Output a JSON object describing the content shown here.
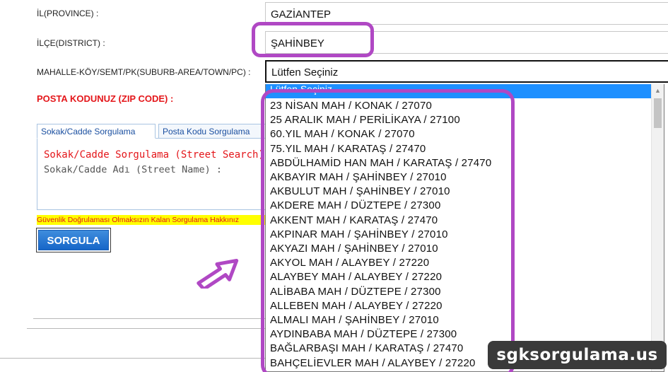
{
  "form": {
    "province_label": "İL(PROVINCE) :",
    "province_value": "GAZİANTEP",
    "district_label": "İLÇE(DISTRICT) :",
    "district_value": "ŞAHİNBEY",
    "neighborhood_label": "MAHALLE-KÖY/SEMT/PK(SUBURB-AREA/TOWN/PC) :",
    "neighborhood_value": "Lütfen Seçiniz",
    "zip_label": "POSTA KODUNUZ (ZIP CODE) :"
  },
  "tabs": [
    {
      "label": "Sokak/Cadde Sorgulama",
      "active": true
    },
    {
      "label": "Posta Kodu Sorgulama",
      "active": false
    }
  ],
  "search_panel": {
    "title": "Sokak/Cadde Sorgulama (Street Search)",
    "field_label": "Sokak/Cadde Adı (Street Name) :"
  },
  "warning_text": "Güvenlik Doğrulaması Olmaksızın Kalan Sorgulama Hakkınız",
  "submit_label": "SORGULA",
  "dropdown": {
    "first_option": "Lütfen Seçiniz",
    "options": [
      "23 NİSAN MAH / KONAK / 27070",
      "25 ARALIK MAH / PERİLİKAYA / 27100",
      "60.YIL MAH / KONAK / 27070",
      "75.YIL MAH / KARATAŞ / 27470",
      "ABDÜLHAMİD HAN MAH / KARATAŞ / 27470",
      "AKBAYIR MAH / ŞAHİNBEY / 27010",
      "AKBULUT MAH / ŞAHİNBEY / 27010",
      "AKDERE MAH / DÜZTEPE / 27300",
      "AKKENT MAH / KARATAŞ / 27470",
      "AKPINAR MAH / ŞAHİNBEY / 27010",
      "AKYAZI MAH / ŞAHİNBEY / 27010",
      "AKYOL MAH / ALAYBEY / 27220",
      "ALAYBEY MAH / ALAYBEY / 27220",
      "ALİBABA MAH / DÜZTEPE / 27300",
      "ALLEBEN MAH / ALAYBEY / 27220",
      "ALMALI MAH / ŞAHİNBEY / 27010",
      "AYDINBABA MAH / DÜZTEPE / 27300",
      "BAĞLARBAŞI MAH / KARATAŞ / 27470",
      "BAHÇELİEVLER MAH / ALAYBEY / 27220"
    ]
  },
  "watermark": "sgksorgulama.us",
  "colors": {
    "highlight": "#b048c4",
    "selected_option": "#1e90ff",
    "required_label": "#e4161a",
    "button": "#1666c8",
    "warning_bg": "#ffff00"
  }
}
